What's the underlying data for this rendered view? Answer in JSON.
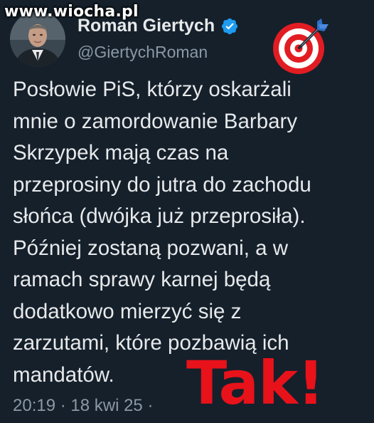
{
  "watermark": "www.wiocha.pl",
  "author": {
    "name": "Roman Giertych",
    "handle": "@GiertychRoman",
    "verified": true
  },
  "tweet": {
    "lines": [
      "Posłowie PiS, którzy oskarżali",
      "mnie o zamordowanie Barbary",
      "Skrzypek mają czas na",
      "przeprosiny do jutra do zachodu",
      "słońca (dwójka już przeprosiła).",
      "Później zostaną pozwani, a w",
      "ramach sprawy karnej będą",
      "dodatkowo mierzyć się z",
      "zarzutami, które pozbawią ich",
      "mandatów."
    ],
    "timestamp": "20:19 · 18 kwi 25 ·"
  },
  "overlay": {
    "tak_label": "Tak!",
    "target_emoji": "direct-hit-icon"
  },
  "colors": {
    "background": "#15202b",
    "text": "#e7e9ea",
    "secondary_text": "#8b98a5",
    "verified": "#1d9bf0",
    "tak": "#e8121a"
  }
}
